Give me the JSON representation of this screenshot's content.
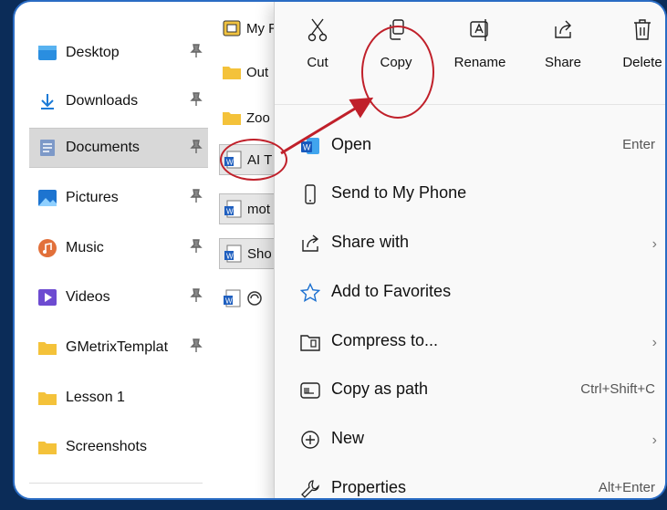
{
  "sidebar": {
    "items": [
      {
        "label": "Desktop",
        "icon": "desktop-icon",
        "pinned": true
      },
      {
        "label": "Downloads",
        "icon": "download-icon",
        "pinned": true
      },
      {
        "label": "Documents",
        "icon": "documents-icon",
        "pinned": true,
        "selected": true
      },
      {
        "label": "Pictures",
        "icon": "pictures-icon",
        "pinned": true
      },
      {
        "label": "Music",
        "icon": "music-icon",
        "pinned": true
      },
      {
        "label": "Videos",
        "icon": "videos-icon",
        "pinned": true
      },
      {
        "label": "GMetrixTemplat",
        "icon": "folder-icon",
        "pinned": true
      },
      {
        "label": "Lesson 1",
        "icon": "folder-icon",
        "pinned": false
      },
      {
        "label": "Screenshots",
        "icon": "folder-icon",
        "pinned": false
      }
    ]
  },
  "files": [
    {
      "label": "My R",
      "icon": "shortcut-icon",
      "selected": false
    },
    {
      "label": "Out",
      "icon": "folder-icon",
      "selected": false
    },
    {
      "label": "Zoo",
      "icon": "folder-icon",
      "selected": false
    },
    {
      "label": "AI T",
      "icon": "word-doc-icon",
      "selected": true
    },
    {
      "label": "mot",
      "icon": "word-doc-icon",
      "selected": true
    },
    {
      "label": "Sho",
      "icon": "word-doc-icon",
      "selected": true
    },
    {
      "label": "",
      "icon": "word-doc-icon",
      "selected": false
    }
  ],
  "context_menu": {
    "quick_actions": [
      {
        "label": "Cut",
        "icon": "scissors-icon"
      },
      {
        "label": "Copy",
        "icon": "copy-icon"
      },
      {
        "label": "Rename",
        "icon": "rename-icon"
      },
      {
        "label": "Share",
        "icon": "share-icon"
      },
      {
        "label": "Delete",
        "icon": "trash-icon"
      }
    ],
    "items": [
      {
        "label": "Open",
        "shortcut": "Enter",
        "icon": "word-icon",
        "submenu": false
      },
      {
        "label": "Send to My Phone",
        "shortcut": "",
        "icon": "phone-icon",
        "submenu": false
      },
      {
        "label": "Share with",
        "shortcut": "",
        "icon": "share-icon",
        "submenu": true
      },
      {
        "label": "Add to Favorites",
        "shortcut": "",
        "icon": "star-icon",
        "submenu": false
      },
      {
        "label": "Compress to...",
        "shortcut": "",
        "icon": "zip-icon",
        "submenu": true
      },
      {
        "label": "Copy as path",
        "shortcut": "Ctrl+Shift+C",
        "icon": "path-icon",
        "submenu": false
      },
      {
        "label": "New",
        "shortcut": "",
        "icon": "plus-circle-icon",
        "submenu": true
      },
      {
        "label": "Properties",
        "shortcut": "Alt+Enter",
        "icon": "wrench-icon",
        "submenu": false
      }
    ],
    "chevron": "›"
  },
  "annotation": {
    "color": "#c0202a",
    "highlight": "Copy"
  },
  "colors": {
    "background": "#0b2c58",
    "frame_border": "#2a6cc4",
    "accent": "#2b7cd3"
  }
}
